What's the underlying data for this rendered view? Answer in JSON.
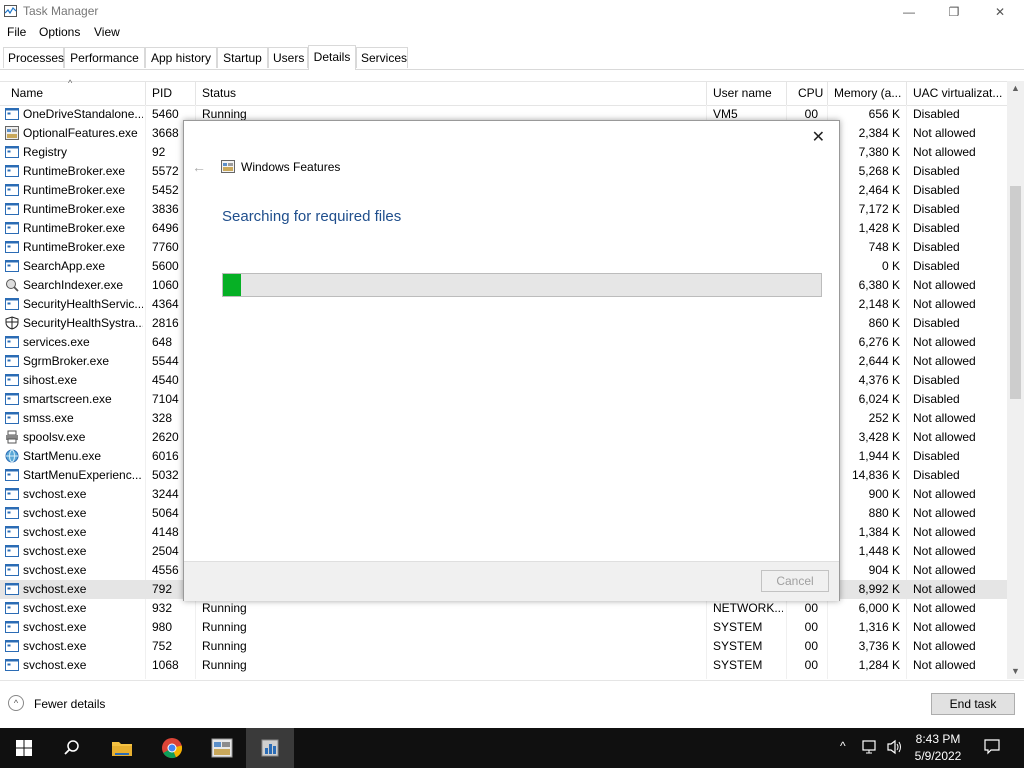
{
  "window": {
    "title": "Task Manager",
    "minimize": "—",
    "maximize": "❐",
    "close": "✕"
  },
  "menu": [
    "File",
    "Options",
    "View"
  ],
  "tabs": [
    {
      "label": "Processes",
      "active": false
    },
    {
      "label": "Performance",
      "active": false
    },
    {
      "label": "App history",
      "active": false
    },
    {
      "label": "Startup",
      "active": false
    },
    {
      "label": "Users",
      "active": false
    },
    {
      "label": "Details",
      "active": true
    },
    {
      "label": "Services",
      "active": false
    }
  ],
  "columns": {
    "name": "Name",
    "pid": "PID",
    "status": "Status",
    "user": "User name",
    "cpu": "CPU",
    "memory": "Memory (a...",
    "uac": "UAC virtualizat..."
  },
  "rows": [
    {
      "icon": "app-icon",
      "name": "OneDriveStandalone...",
      "pid": "5460",
      "status": "Running",
      "user": "VM5",
      "cpu": "00",
      "memory": "656 K",
      "uac": "Disabled"
    },
    {
      "icon": "features-icon",
      "name": "OptionalFeatures.exe",
      "pid": "3668",
      "status": "",
      "user": "",
      "cpu": "",
      "memory": "2,384 K",
      "uac": "Not allowed"
    },
    {
      "icon": "app-icon",
      "name": "Registry",
      "pid": "92",
      "status": "",
      "user": "",
      "cpu": "",
      "memory": "7,380 K",
      "uac": "Not allowed"
    },
    {
      "icon": "app-icon",
      "name": "RuntimeBroker.exe",
      "pid": "5572",
      "status": "",
      "user": "",
      "cpu": "",
      "memory": "5,268 K",
      "uac": "Disabled"
    },
    {
      "icon": "app-icon",
      "name": "RuntimeBroker.exe",
      "pid": "5452",
      "status": "",
      "user": "",
      "cpu": "",
      "memory": "2,464 K",
      "uac": "Disabled"
    },
    {
      "icon": "app-icon",
      "name": "RuntimeBroker.exe",
      "pid": "3836",
      "status": "",
      "user": "",
      "cpu": "",
      "memory": "7,172 K",
      "uac": "Disabled"
    },
    {
      "icon": "app-icon",
      "name": "RuntimeBroker.exe",
      "pid": "6496",
      "status": "",
      "user": "",
      "cpu": "",
      "memory": "1,428 K",
      "uac": "Disabled"
    },
    {
      "icon": "app-icon",
      "name": "RuntimeBroker.exe",
      "pid": "7760",
      "status": "",
      "user": "",
      "cpu": "",
      "memory": "748 K",
      "uac": "Disabled"
    },
    {
      "icon": "app-icon",
      "name": "SearchApp.exe",
      "pid": "5600",
      "status": "",
      "user": "",
      "cpu": "",
      "memory": "0 K",
      "uac": "Disabled"
    },
    {
      "icon": "search-indexer-icon",
      "name": "SearchIndexer.exe",
      "pid": "1060",
      "status": "",
      "user": "",
      "cpu": "",
      "memory": "6,380 K",
      "uac": "Not allowed"
    },
    {
      "icon": "app-icon",
      "name": "SecurityHealthServic...",
      "pid": "4364",
      "status": "",
      "user": "",
      "cpu": "",
      "memory": "2,148 K",
      "uac": "Not allowed"
    },
    {
      "icon": "shield-icon",
      "name": "SecurityHealthSystra...",
      "pid": "2816",
      "status": "",
      "user": "",
      "cpu": "",
      "memory": "860 K",
      "uac": "Disabled"
    },
    {
      "icon": "app-icon",
      "name": "services.exe",
      "pid": "648",
      "status": "",
      "user": "",
      "cpu": "",
      "memory": "6,276 K",
      "uac": "Not allowed"
    },
    {
      "icon": "app-icon",
      "name": "SgrmBroker.exe",
      "pid": "5544",
      "status": "",
      "user": "",
      "cpu": "",
      "memory": "2,644 K",
      "uac": "Not allowed"
    },
    {
      "icon": "app-icon",
      "name": "sihost.exe",
      "pid": "4540",
      "status": "",
      "user": "",
      "cpu": "",
      "memory": "4,376 K",
      "uac": "Disabled"
    },
    {
      "icon": "app-icon",
      "name": "smartscreen.exe",
      "pid": "7104",
      "status": "",
      "user": "",
      "cpu": "",
      "memory": "6,024 K",
      "uac": "Disabled"
    },
    {
      "icon": "app-icon",
      "name": "smss.exe",
      "pid": "328",
      "status": "",
      "user": "",
      "cpu": "",
      "memory": "252 K",
      "uac": "Not allowed"
    },
    {
      "icon": "printer-icon",
      "name": "spoolsv.exe",
      "pid": "2620",
      "status": "",
      "user": "",
      "cpu": "",
      "memory": "3,428 K",
      "uac": "Not allowed"
    },
    {
      "icon": "globe-icon",
      "name": "StartMenu.exe",
      "pid": "6016",
      "status": "",
      "user": "",
      "cpu": "",
      "memory": "1,944 K",
      "uac": "Disabled"
    },
    {
      "icon": "app-icon",
      "name": "StartMenuExperienc...",
      "pid": "5032",
      "status": "",
      "user": "",
      "cpu": "",
      "memory": "14,836 K",
      "uac": "Disabled"
    },
    {
      "icon": "app-icon",
      "name": "svchost.exe",
      "pid": "3244",
      "status": "",
      "user": "",
      "cpu": "",
      "memory": "900 K",
      "uac": "Not allowed"
    },
    {
      "icon": "app-icon",
      "name": "svchost.exe",
      "pid": "5064",
      "status": "",
      "user": "",
      "cpu": "",
      "memory": "880 K",
      "uac": "Not allowed"
    },
    {
      "icon": "app-icon",
      "name": "svchost.exe",
      "pid": "4148",
      "status": "",
      "user": "",
      "cpu": "",
      "memory": "1,384 K",
      "uac": "Not allowed"
    },
    {
      "icon": "app-icon",
      "name": "svchost.exe",
      "pid": "2504",
      "status": "",
      "user": "",
      "cpu": "",
      "memory": "1,448 K",
      "uac": "Not allowed"
    },
    {
      "icon": "app-icon",
      "name": "svchost.exe",
      "pid": "4556",
      "status": "",
      "user": "",
      "cpu": "",
      "memory": "904 K",
      "uac": "Not allowed"
    },
    {
      "icon": "app-icon",
      "name": "svchost.exe",
      "pid": "792",
      "status": "",
      "user": "",
      "cpu": "",
      "memory": "8,992 K",
      "uac": "Not allowed",
      "selected": true
    },
    {
      "icon": "app-icon",
      "name": "svchost.exe",
      "pid": "932",
      "status": "Running",
      "user": "NETWORK...",
      "cpu": "00",
      "memory": "6,000 K",
      "uac": "Not allowed"
    },
    {
      "icon": "app-icon",
      "name": "svchost.exe",
      "pid": "980",
      "status": "Running",
      "user": "SYSTEM",
      "cpu": "00",
      "memory": "1,316 K",
      "uac": "Not allowed"
    },
    {
      "icon": "app-icon",
      "name": "svchost.exe",
      "pid": "752",
      "status": "Running",
      "user": "SYSTEM",
      "cpu": "00",
      "memory": "3,736 K",
      "uac": "Not allowed"
    },
    {
      "icon": "app-icon",
      "name": "svchost.exe",
      "pid": "1068",
      "status": "Running",
      "user": "SYSTEM",
      "cpu": "00",
      "memory": "1,284 K",
      "uac": "Not allowed"
    }
  ],
  "footer": {
    "fewer_details": "Fewer details",
    "end_task": "End task"
  },
  "dialog": {
    "title": "Windows Features",
    "heading": "Searching for required files",
    "progress": 0.03,
    "progress_color": "#06b025",
    "cancel": "Cancel",
    "close": "✕",
    "back": "←"
  },
  "taskbar": {
    "items": [
      "start-icon",
      "search-icon",
      "file-explorer-icon",
      "chrome-icon",
      "features-icon",
      "task-manager-icon"
    ],
    "time": "8:43 PM",
    "date": "5/9/2022"
  }
}
